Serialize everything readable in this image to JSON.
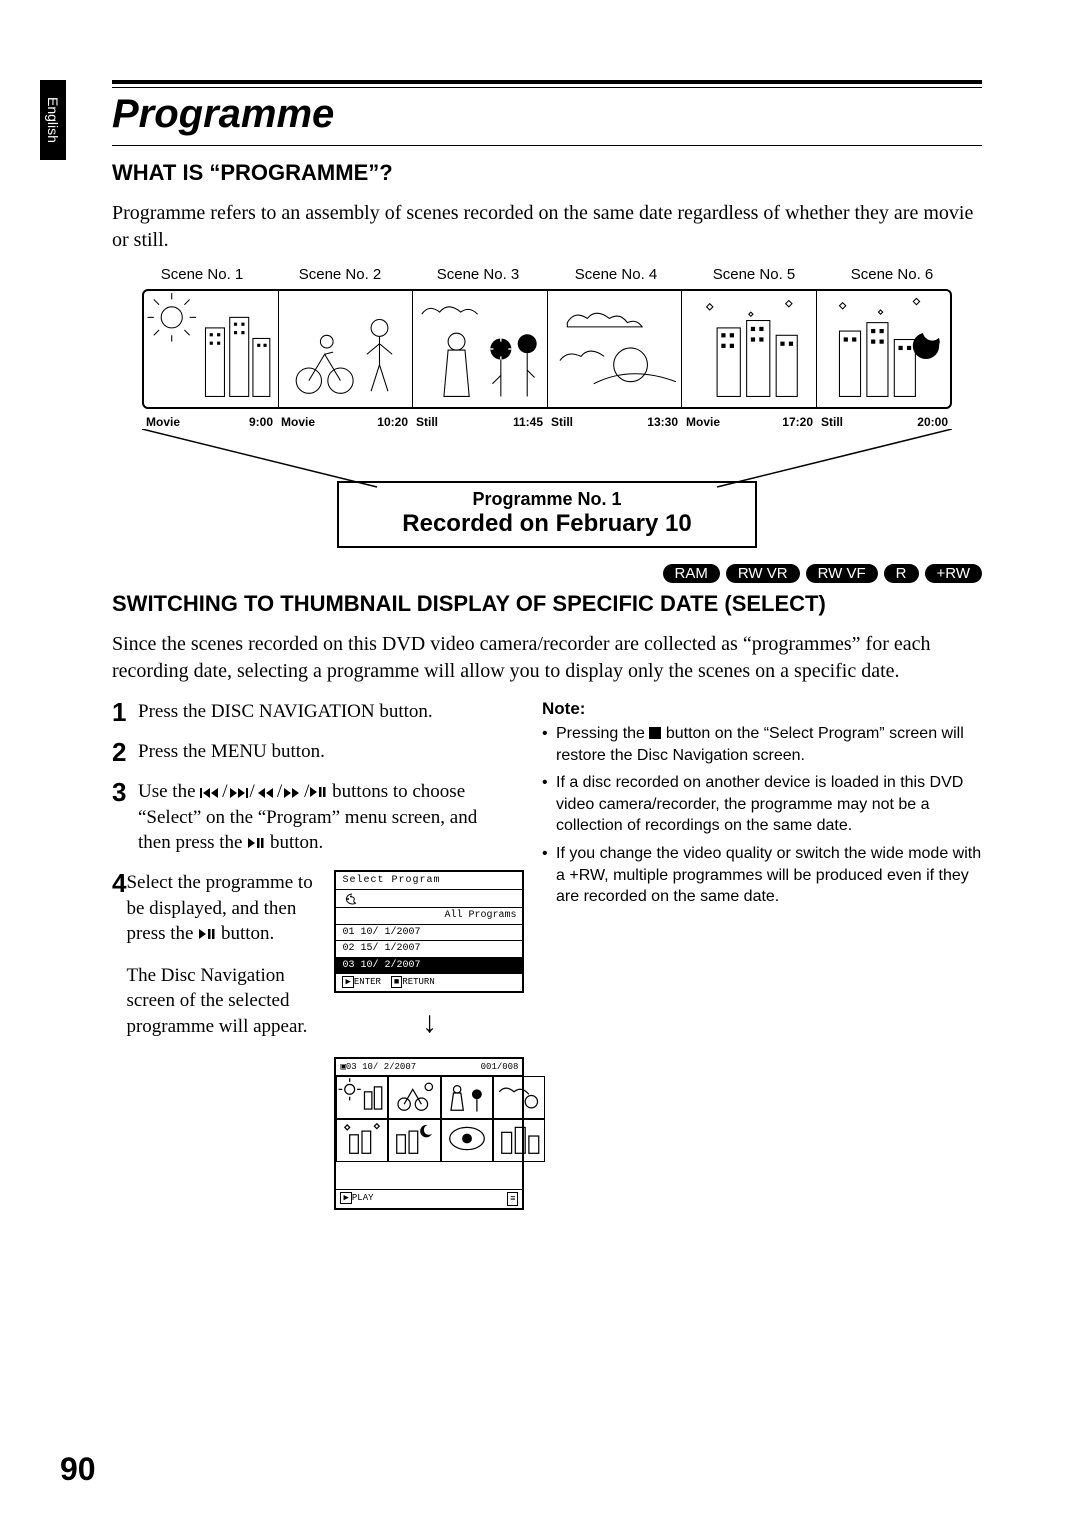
{
  "side_tab": "English",
  "title": "Programme",
  "section1_heading": "WHAT IS “PROGRAMME”?",
  "section1_body": "Programme refers to an assembly of scenes recorded on the same date regardless of whether they are movie or still.",
  "scenes": [
    {
      "label": "Scene No. 1",
      "type": "Movie",
      "time": "9:00"
    },
    {
      "label": "Scene No. 2",
      "type": "Movie",
      "time": "10:20"
    },
    {
      "label": "Scene No. 3",
      "type": "Still",
      "time": "11:45"
    },
    {
      "label": "Scene No. 4",
      "type": "Still",
      "time": "13:30"
    },
    {
      "label": "Scene No. 5",
      "type": "Movie",
      "time": "17:20"
    },
    {
      "label": "Scene No. 6",
      "type": "Still",
      "time": "20:00"
    }
  ],
  "programme_box_line1": "Programme No. 1",
  "programme_box_line2": "Recorded on February 10",
  "formats": [
    "RAM",
    "RW VR",
    "RW VF",
    "R",
    "+RW"
  ],
  "section2_heading": "SWITCHING TO THUMBNAIL DISPLAY OF SPECIFIC DATE (SELECT)",
  "section2_body": "Since the scenes recorded on this DVD video camera/recorder are collected as “programmes” for each recording date, selecting a programme will allow you to display only the scenes on a specific date.",
  "steps": {
    "s1": "Press the DISC NAVIGATION button.",
    "s2": "Press the MENU button.",
    "s3_a": "Use the ",
    "s3_b": " buttons to choose “Select” on the “Program” menu screen, and then press the ",
    "s3_c": " button.",
    "s4_a": "Select the programme to be displayed, and then press the ",
    "s4_b": " button.",
    "s4_c": "The Disc Navigation screen of the selected programme will appear."
  },
  "select_program_screen": {
    "title": "Select Program",
    "rows": [
      "All Programs",
      "01  10/ 1/2007",
      "02  15/ 1/2007",
      "03  10/ 2/2007"
    ],
    "selected_index": 3,
    "footer": [
      "ENTER",
      "RETURN"
    ]
  },
  "thumb_screen": {
    "idx": "03",
    "date": "10/ 2/2007",
    "counter": "001/008",
    "play": "PLAY"
  },
  "note_heading": "Note:",
  "notes": [
    {
      "pre": "Pressing the ",
      "post": " button on the “Select Program” screen will restore the Disc Navigation screen."
    },
    {
      "text": "If a disc recorded on another device is loaded in this DVD video camera/recorder, the programme may not be a collection of recordings on the same date."
    },
    {
      "text": "If you change the video quality or switch the wide mode with a +RW, multiple programmes will be produced even if they are recorded on the same date."
    }
  ],
  "page_number": "90"
}
